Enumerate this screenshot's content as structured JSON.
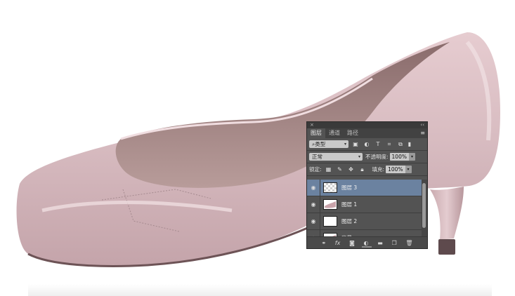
{
  "panel": {
    "tabs": [
      {
        "label": "图层",
        "active": true
      },
      {
        "label": "通道",
        "active": false
      },
      {
        "label": "路径",
        "active": false
      }
    ],
    "close_glyph": "×",
    "collapse_glyph": "‹‹",
    "menu_glyph": "≡",
    "filter": {
      "label": "类型",
      "icon": "search-icon"
    },
    "blend_mode": "正常",
    "opacity_label": "不透明度:",
    "opacity_value": "100%",
    "lock_label": "锁定:",
    "fill_label": "填充:",
    "fill_value": "100%",
    "layers": [
      {
        "name": "图层 3",
        "selected": true,
        "thumb": "transparent"
      },
      {
        "name": "图层 1",
        "selected": false,
        "thumb": "shoe"
      },
      {
        "name": "图层 2",
        "selected": false,
        "thumb": "white"
      },
      {
        "name": "背景",
        "selected": false,
        "thumb": "shoe"
      }
    ],
    "bottom_icons": [
      "link-icon",
      "fx-icon",
      "mask-icon",
      "adjustment-icon",
      "folder-icon",
      "new-layer-icon",
      "trash-icon"
    ]
  },
  "colors": {
    "panel_bg": "#535353",
    "selected_row": "#6b82a0",
    "shoe": "#d8bcc1"
  }
}
